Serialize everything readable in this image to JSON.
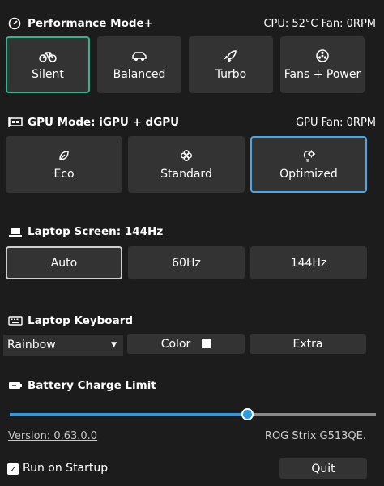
{
  "performance": {
    "title": "Performance Mode+",
    "status": "CPU: 52°C  Fan: 0RPM",
    "modes": [
      {
        "label": "Silent",
        "icon": "bicycle-icon",
        "selected": true
      },
      {
        "label": "Balanced",
        "icon": "car-icon",
        "selected": false
      },
      {
        "label": "Turbo",
        "icon": "rocket-icon",
        "selected": false
      },
      {
        "label": "Fans + Power",
        "icon": "fan-icon",
        "selected": false
      }
    ]
  },
  "gpu": {
    "title": "GPU Mode: iGPU + dGPU",
    "status": "GPU Fan: 0RPM",
    "modes": [
      {
        "label": "Eco",
        "icon": "leaf-icon",
        "selected": false
      },
      {
        "label": "Standard",
        "icon": "flower-icon",
        "selected": false
      },
      {
        "label": "Optimized",
        "icon": "bulb-gear-icon",
        "selected": true
      }
    ]
  },
  "screen": {
    "title": "Laptop Screen: 144Hz",
    "options": [
      {
        "label": "Auto",
        "selected": true
      },
      {
        "label": "60Hz",
        "selected": false
      },
      {
        "label": "144Hz",
        "selected": false
      }
    ]
  },
  "keyboard": {
    "title": "Laptop Keyboard",
    "mode_value": "Rainbow",
    "color_label": "Color",
    "swatch_color": "#ffffff",
    "extra_label": "Extra"
  },
  "battery": {
    "title": "Battery Charge Limit",
    "charge_limit_fraction": 0.65
  },
  "footer": {
    "version": "Version: 0.63.0.0",
    "model": "ROG Strix G513QE.",
    "startup_label": "Run on Startup",
    "startup_checked": true,
    "quit_label": "Quit"
  },
  "colors": {
    "background": "#1c1c1c",
    "button": "#333333",
    "selected_green": "#2fb58f",
    "selected_blue": "#46a8e8",
    "slider_blue": "#2e9be0"
  }
}
